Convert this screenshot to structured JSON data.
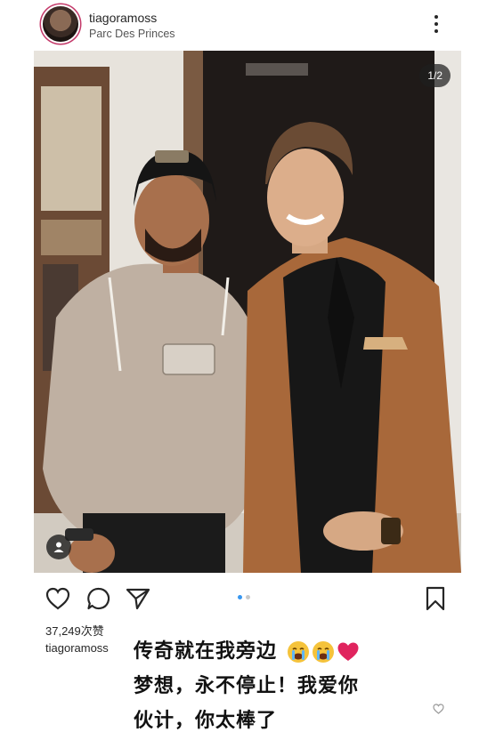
{
  "post": {
    "username": "tiagoramoss",
    "location": "Parc Des Princes",
    "media_counter": "1/2",
    "carousel": {
      "total": 2,
      "active": 1
    },
    "likes": "37,249次赞",
    "caption": {
      "user": "tiagoramoss",
      "line1": "传奇就在我旁边",
      "line2": "梦想，永不停止！我爱你",
      "line3": "伙计，你太棒了"
    }
  },
  "icons": {
    "more": "more-options-icon",
    "like": "heart-icon",
    "comment": "comment-icon",
    "share": "paper-plane-icon",
    "save": "bookmark-icon",
    "tag": "person-tag-icon",
    "caption_like": "small-heart-icon"
  },
  "colors": {
    "text": "#262626",
    "subtext": "#555555",
    "active_dot": "#3897f0",
    "inactive_dot": "#c9c9c9",
    "heart_emoji": "#e0245e",
    "crying_emoji": "#f5c33b"
  }
}
